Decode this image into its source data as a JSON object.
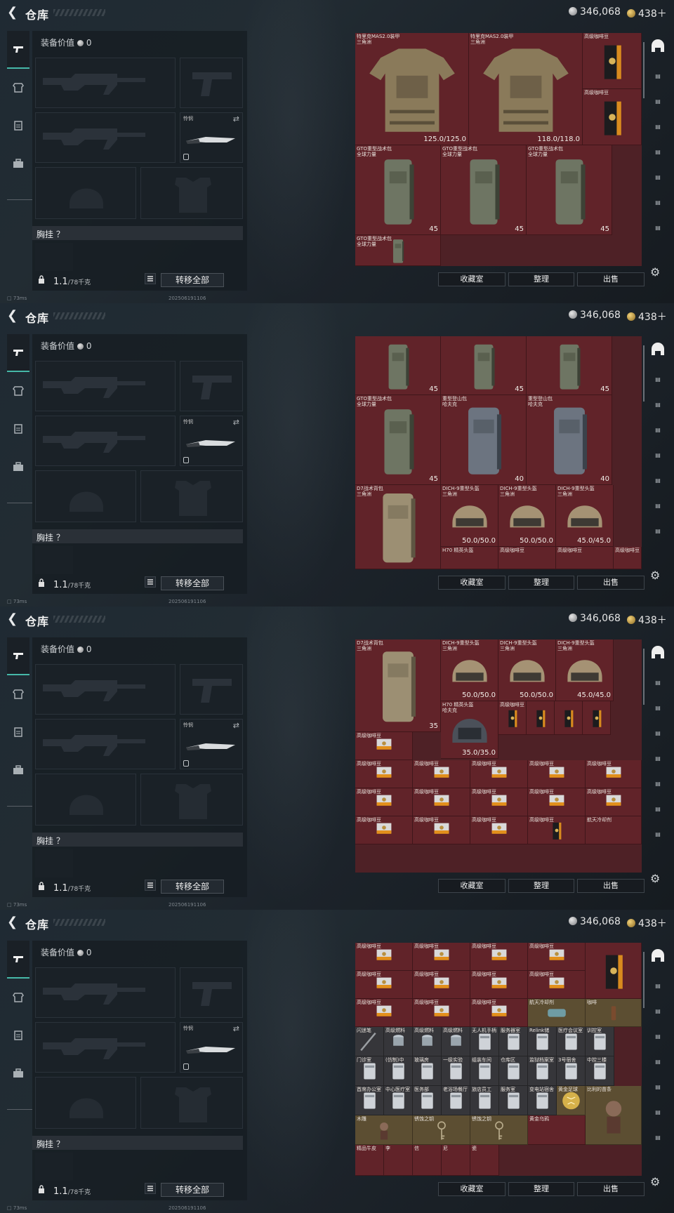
{
  "header": {
    "title": "仓库",
    "silver": "346,068",
    "gold": "438＋"
  },
  "left": {
    "value_label": "装备价值",
    "value": "0",
    "knife_label": "怜悯",
    "chest_label": "胸挂 ？",
    "weight": "1.1",
    "weight_cap": "/78千克",
    "transfer_label": "转移全部"
  },
  "status": {
    "ping": "73ms",
    "timestamp": "202506191106"
  },
  "buttons": {
    "favorites": "收藏室",
    "sort": "整理",
    "sell": "出售"
  },
  "icons": {
    "back": "chevron-left-icon",
    "currency_silver": "silver-coin-icon",
    "currency_gold": "gold-coin-icon",
    "settings": "gear-icon",
    "lock": "lock-icon",
    "list": "list-icon",
    "swap": "swap-icon"
  },
  "colors": {
    "grid_bg": "#4e2126",
    "cell_red": "#612329",
    "accent": "#46b8a8"
  },
  "frames": [
    {
      "items": [
        {
          "name": "特里克MAS2.0装甲\n三角洲",
          "type": "armor",
          "dur": "125.0/125.0"
        },
        {
          "name": "特里克MAS2.0装甲\n三角洲",
          "type": "armor",
          "dur": "118.0/118.0"
        },
        {
          "name": "高级咖啡豆",
          "type": "coffee"
        },
        {
          "name": "高级咖啡豆",
          "type": "coffee"
        },
        {
          "name": "GTO重型战术包\n全球力量",
          "type": "pack",
          "cap": "45"
        },
        {
          "name": "GTO重型战术包\n全球力量",
          "type": "pack",
          "cap": "45"
        },
        {
          "name": "GTO重型战术包\n全球力量",
          "type": "pack",
          "cap": "45"
        },
        {
          "name": "GTO重型战术包\n全球力量",
          "type": "packtop"
        }
      ]
    },
    {
      "items": [
        {
          "name": "",
          "type": "packbot",
          "cap": "45"
        },
        {
          "name": "",
          "type": "packbot",
          "cap": "45"
        },
        {
          "name": "",
          "type": "packbot",
          "cap": "45"
        },
        {
          "name": "GTO重型战术包\n全球力量",
          "type": "pack",
          "cap": "45"
        },
        {
          "name": "重型登山包\n哈夫克",
          "type": "packgray",
          "cap": "40"
        },
        {
          "name": "重型登山包\n哈夫克",
          "type": "packgray",
          "cap": "40"
        },
        {
          "name": "D7战术背包\n三角洲",
          "type": "packtan"
        },
        {
          "name": "DICH-9重型头盔\n三角洲",
          "type": "helmet",
          "dur": "50.0/50.0"
        },
        {
          "name": "DICH-9重型头盔\n三角洲",
          "type": "helmet",
          "dur": "50.0/50.0"
        },
        {
          "name": "DICH-9重型头盔\n三角洲",
          "type": "helmet",
          "dur": "45.0/45.0"
        },
        {
          "name": "H70 精英头盔",
          "type": "text"
        },
        {
          "name": "高级咖啡豆",
          "type": "text"
        },
        {
          "name": "高级咖啡豆",
          "type": "text"
        },
        {
          "name": "高级咖啡豆",
          "type": "text"
        }
      ]
    },
    {
      "items": [
        {
          "name": "D7战术背包\n三角洲",
          "type": "packtan",
          "cap": "35"
        },
        {
          "name": "DICH-9重型头盔\n三角洲",
          "type": "helmet",
          "dur": "50.0/50.0"
        },
        {
          "name": "DICH-9重型头盔\n三角洲",
          "type": "helmet",
          "dur": "50.0/50.0"
        },
        {
          "name": "DICH-9重型头盔\n三角洲",
          "type": "helmet",
          "dur": "45.0/45.0"
        },
        {
          "name": "H70 精英头盔\n哈夫克",
          "type": "helmetblack",
          "dur": "35.0/35.0"
        },
        {
          "name": "高级咖啡豆",
          "type": "coffee"
        },
        {
          "name": "",
          "type": "coffee"
        },
        {
          "name": "",
          "type": "coffee"
        },
        {
          "name": "",
          "type": "coffee"
        },
        {
          "name": "高级咖啡豆",
          "type": "coffeebox"
        },
        {
          "name": "高级咖啡豆",
          "type": "coffeebox"
        },
        {
          "name": "高级咖啡豆",
          "type": "coffeebox"
        },
        {
          "name": "高级咖啡豆",
          "type": "coffeebox"
        },
        {
          "name": "高级咖啡豆",
          "type": "coffeebox"
        },
        {
          "name": "高级咖啡豆",
          "type": "coffeebox"
        },
        {
          "name": "高级咖啡豆",
          "type": "coffeebox"
        },
        {
          "name": "高级咖啡豆",
          "type": "coffeebox"
        },
        {
          "name": "高级咖啡豆",
          "type": "coffeebox"
        },
        {
          "name": "高级咖啡豆",
          "type": "coffeebox"
        },
        {
          "name": "高级咖啡豆",
          "type": "coffeebox"
        },
        {
          "name": "高级咖啡豆",
          "type": "coffeebox"
        },
        {
          "name": "高级咖啡豆",
          "type": "coffeebox"
        },
        {
          "name": "高级咖啡豆",
          "type": "coffeebox"
        },
        {
          "name": "高级咖啡豆",
          "type": "coffee"
        },
        {
          "name": "航天冷却剂",
          "type": "text"
        }
      ]
    },
    {
      "items": [
        {
          "name": "高级咖啡豆",
          "type": "coffeebox"
        },
        {
          "name": "高级咖啡豆",
          "type": "coffeebox"
        },
        {
          "name": "高级咖啡豆",
          "type": "coffeebox"
        },
        {
          "name": "高级咖啡豆",
          "type": "coffeebox"
        },
        {
          "name": "",
          "type": "coffee"
        },
        {
          "name": "高级咖啡豆",
          "type": "coffeebox"
        },
        {
          "name": "高级咖啡豆",
          "type": "coffeebox"
        },
        {
          "name": "高级咖啡豆",
          "type": "coffeebox"
        },
        {
          "name": "高级咖啡豆",
          "type": "coffeebox"
        },
        {
          "name": "高级咖啡豆",
          "type": "coffeebox"
        },
        {
          "name": "高级咖啡豆",
          "type": "coffeebox"
        },
        {
          "name": "高级咖啡豆",
          "type": "coffeebox"
        },
        {
          "name": "航天冷却剂",
          "type": "coolant"
        },
        {
          "name": "咖啡",
          "type": "bottle"
        },
        {
          "name": "闪迷笔",
          "type": "key"
        },
        {
          "name": "高级燃料",
          "type": "can"
        },
        {
          "name": "高级燃料",
          "type": "can"
        },
        {
          "name": "高级燃料",
          "type": "can"
        },
        {
          "name": "无人机手柄",
          "type": "card"
        },
        {
          "name": "服务器室",
          "type": "card"
        },
        {
          "name": "Relink储",
          "type": "card"
        },
        {
          "name": "医疗会议室",
          "type": "card"
        },
        {
          "name": "训控室",
          "type": "card"
        },
        {
          "name": "门诊室",
          "type": "card"
        },
        {
          "name": "(仿制)中",
          "type": "card"
        },
        {
          "name": "玻璃房",
          "type": "card"
        },
        {
          "name": "一级实验",
          "type": "card"
        },
        {
          "name": "组装车间",
          "type": "card"
        },
        {
          "name": "仓库区",
          "type": "card"
        },
        {
          "name": "监狱档案室",
          "type": "card"
        },
        {
          "name": "3号宿舍",
          "type": "card"
        },
        {
          "name": "中控三楼",
          "type": "card"
        },
        {
          "name": "首席办公室",
          "type": "card"
        },
        {
          "name": "中心医疗室",
          "type": "card"
        },
        {
          "name": "医务部",
          "type": "card"
        },
        {
          "name": "老浴场餐厅",
          "type": "card"
        },
        {
          "name": "旅店员工",
          "type": "card"
        },
        {
          "name": "服务室",
          "type": "card"
        },
        {
          "name": "变电站宿舍",
          "type": "card"
        },
        {
          "name": "黄金足球",
          "type": "ball"
        },
        {
          "name": "比利的苗条",
          "type": "doll"
        },
        {
          "name": "木雕",
          "type": "doll"
        },
        {
          "name": "锈蚀之钥",
          "type": "keyold"
        },
        {
          "name": "锈蚀之钥",
          "type": "keyold"
        },
        {
          "name": "黄金乌鸦",
          "type": "text"
        },
        {
          "name": "精品牛皮",
          "type": "text"
        },
        {
          "name": "李",
          "type": "text"
        },
        {
          "name": "信",
          "type": "text"
        },
        {
          "name": "尼",
          "type": "text"
        },
        {
          "name": "瓷",
          "type": "text"
        }
      ]
    }
  ]
}
